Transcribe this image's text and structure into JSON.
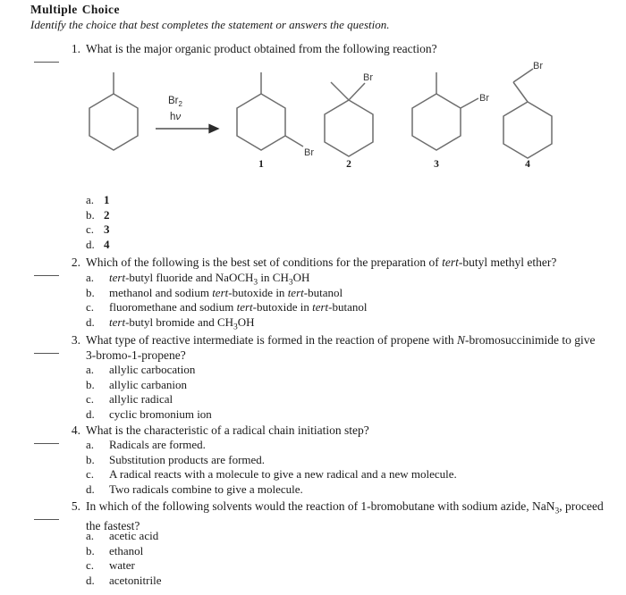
{
  "header": {
    "title_word_1": "Multiple",
    "title_word_2": "Choice",
    "directions": "Identify the choice that best completes the statement or answers the question."
  },
  "questions": [
    {
      "number": "1.",
      "blank": "",
      "text": "What is the major organic product obtained from the following reaction?",
      "options": [
        {
          "letter": "a.",
          "value": "1",
          "bold": true
        },
        {
          "letter": "b.",
          "value": "2",
          "bold": true
        },
        {
          "letter": "c.",
          "value": "3",
          "bold": true
        },
        {
          "letter": "d.",
          "value": "4",
          "bold": true
        }
      ]
    },
    {
      "number": "2.",
      "blank": "",
      "text_html": "Which of the following is the best set of conditions for the preparation of <i>tert</i>-butyl methyl ether?",
      "options": [
        {
          "letter": "a.",
          "html": "<i>tert</i>-butyl fluoride and NaOCH<sub>3</sub> in CH<sub>3</sub>OH"
        },
        {
          "letter": "b.",
          "html": "methanol and sodium <i>tert</i>-butoxide in <i>tert</i>-butanol"
        },
        {
          "letter": "c.",
          "html": "fluoromethane and sodium <i>tert</i>-butoxide in <i>tert</i>-butanol"
        },
        {
          "letter": "d.",
          "html": "<i>tert</i>-butyl bromide and CH<sub>3</sub>OH"
        }
      ]
    },
    {
      "number": "3.",
      "blank": "",
      "text_html": "What type of reactive intermediate is formed in the reaction of propene with <i>N</i>-bromosuccinimide to give&nbsp; 3-bromo-1-propene?",
      "options": [
        {
          "letter": "a.",
          "html": "allylic carbocation"
        },
        {
          "letter": "b.",
          "html": "allylic carbanion"
        },
        {
          "letter": "c.",
          "html": "allylic radical"
        },
        {
          "letter": "d.",
          "html": "cyclic bromonium ion"
        }
      ]
    },
    {
      "number": "4.",
      "blank": "",
      "text_html": "What is the characteristic of a radical chain initiation step?",
      "options": [
        {
          "letter": "a.",
          "html": "Radicals are formed."
        },
        {
          "letter": "b.",
          "html": "Substitution products are formed."
        },
        {
          "letter": "c.",
          "html": "A radical reacts with a molecule to give a new radical and a new molecule."
        },
        {
          "letter": "d.",
          "html": "Two radicals combine to give a molecule."
        }
      ]
    },
    {
      "number": "5.",
      "blank": "",
      "text_html": "In which of the following solvents would the reaction of 1-bromobutane with sodium azide, NaN<sub>3</sub>, proceed the fastest?",
      "options": [
        {
          "letter": "a.",
          "html": "acetic acid"
        },
        {
          "letter": "b.",
          "html": "ethanol"
        },
        {
          "letter": "c.",
          "html": "water"
        },
        {
          "letter": "d.",
          "html": "acetonitrile"
        }
      ]
    }
  ],
  "scheme": {
    "reactant_name": "methylcyclohexane",
    "conditions": {
      "reagent": "Br",
      "reagent_sub": "2",
      "light_h": "h",
      "light_nu": "ν"
    },
    "bromine_label": "Br",
    "products": [
      {
        "label": "1",
        "name": "3-bromo-1-methylcyclohexane",
        "br_label": "Br"
      },
      {
        "label": "2",
        "name": "1-bromo-1-methylcyclohexane",
        "br_label": "Br"
      },
      {
        "label": "3",
        "name": "1-bromo-2-methylcyclohexane",
        "br_label": "Br"
      },
      {
        "label": "4",
        "name": "(bromomethyl)cyclohexane",
        "br_label": "Br"
      }
    ]
  }
}
